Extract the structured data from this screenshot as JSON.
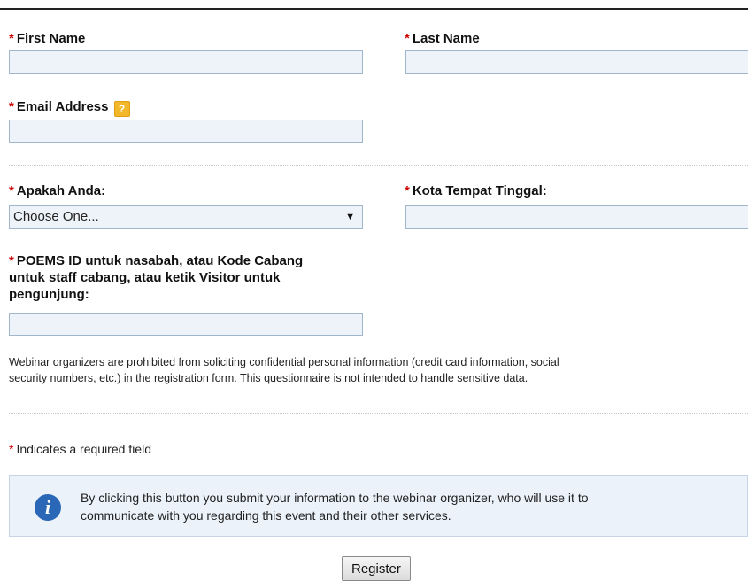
{
  "form": {
    "first_name": {
      "label": "First Name",
      "value": "",
      "required_marker": "*"
    },
    "last_name": {
      "label": "Last Name",
      "value": "",
      "required_marker": "*"
    },
    "email": {
      "label": "Email Address",
      "value": "",
      "required_marker": "*",
      "help_icon": "question-help-icon",
      "help_glyph": "?"
    },
    "apakah_anda": {
      "label": "Apakah Anda:",
      "selected": "Choose One...",
      "required_marker": "*",
      "arrow": "▼"
    },
    "kota": {
      "label": "Kota Tempat Tinggal:",
      "value": "",
      "required_marker": "*"
    },
    "poems_id": {
      "label_line1": "POEMS ID untuk nasabah, atau Kode Cabang",
      "label_line2": "untuk staff cabang, atau ketik Visitor untuk",
      "label_line3": "pengunjung:",
      "value": "",
      "required_marker": "*"
    }
  },
  "notice": {
    "line1": "Webinar organizers are prohibited from soliciting confidential personal information (credit card information, social",
    "line2": "security numbers, etc.) in the registration form. This questionnaire is not intended to handle sensitive data."
  },
  "required_note": {
    "marker": "*",
    "text": "Indicates a required field"
  },
  "info": {
    "icon": "info-icon",
    "glyph": "i",
    "line1": "By clicking this button you submit your information to the webinar organizer, who will use it to",
    "line2": "communicate with you regarding this event and their other services."
  },
  "register_button": {
    "label": "Register"
  },
  "colors": {
    "required": "#cc0000",
    "field_bg": "#eef3f9",
    "field_border": "#9fb6cc",
    "info_bg": "#ecf2fa",
    "info_icon": "#2a67b6",
    "help_icon": "#f3b82a"
  }
}
